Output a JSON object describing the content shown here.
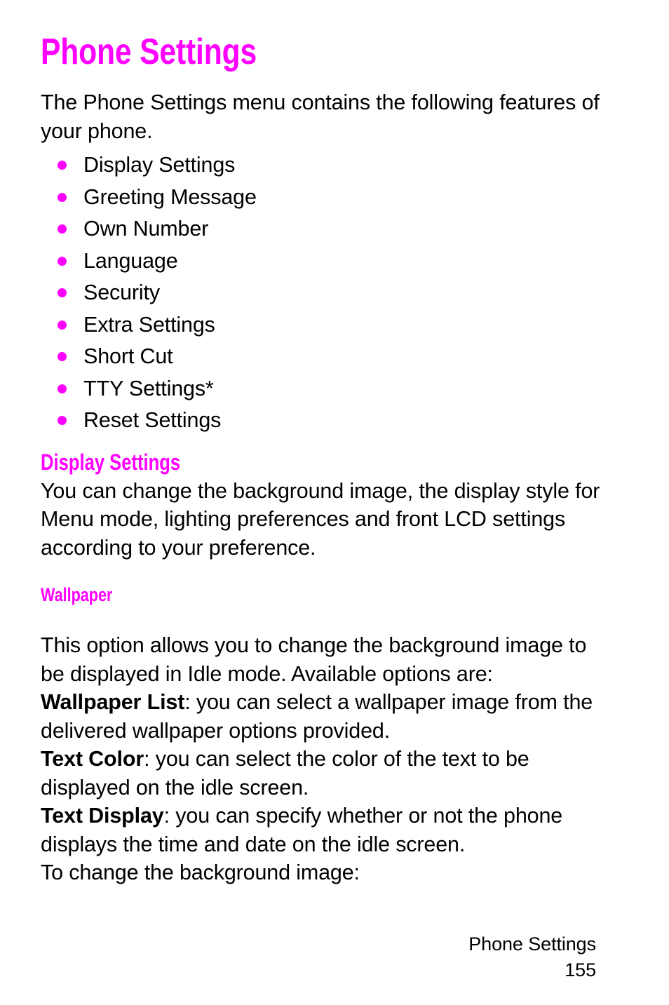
{
  "document": {
    "title": "Phone Settings",
    "accent_color": "#ff00ff",
    "text_color": "#000000",
    "background_color": "#ffffff"
  },
  "intro": {
    "paragraph": "The Phone Settings menu contains the following features of your phone."
  },
  "feature_list": {
    "bullet_icon": "filled-circle-bullet",
    "items": [
      "Display Settings",
      "Greeting Message",
      "Own Number",
      "Language",
      "Security",
      "Extra Settings",
      "Short Cut",
      "TTY Settings*",
      "Reset Settings"
    ]
  },
  "display_settings": {
    "heading": "Display Settings",
    "paragraph": "You can change the background image, the display style for Menu mode, lighting preferences and front LCD settings  according to your preference."
  },
  "wallpaper": {
    "heading": "Wallpaper",
    "intro": "This option allows you to change the background image to be displayed in Idle mode. Available options are:",
    "options": [
      {
        "label": "Wallpaper List",
        "separator": ": ",
        "description": "you can select a wallpaper image from the delivered wallpaper options provided."
      },
      {
        "label": "Text Color",
        "separator": ": ",
        "description": "you can select the color of the text to be displayed on the idle screen."
      },
      {
        "label": "Text Display",
        "separator": ": ",
        "description": "you can specify whether or not the phone displays the time and date on the idle screen."
      }
    ],
    "closing": "To change the background image:"
  },
  "footer": {
    "section": "Phone Settings",
    "page_number": "155"
  }
}
